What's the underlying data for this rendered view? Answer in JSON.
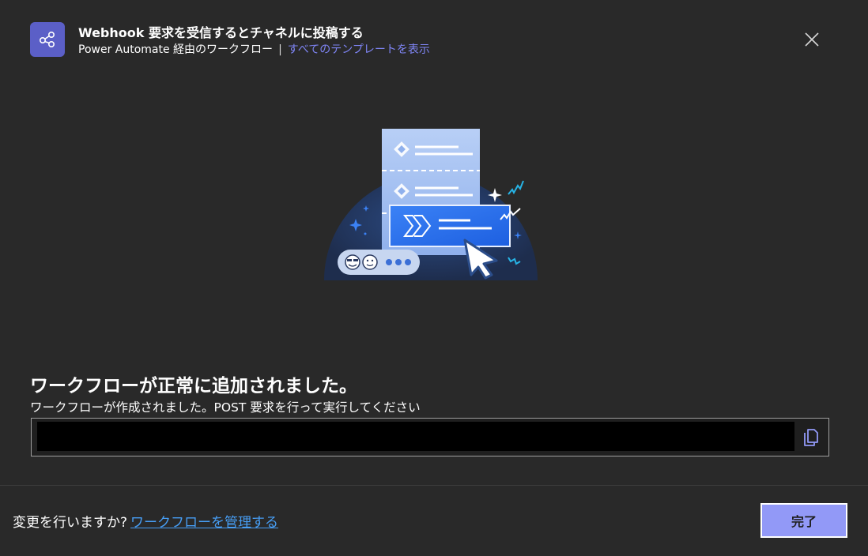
{
  "header": {
    "icon": "flow-share-icon",
    "title": "Webhook 要求を受信するとチャネルに投稿する",
    "subtitle_prefix": "Power Automate 経由のワークフロー",
    "separator": "|",
    "view_templates_link": "すべてのテンプレートを表示",
    "close_icon": "close-icon"
  },
  "illustration": {
    "name": "workflow-success-illustration"
  },
  "main": {
    "success_title": "ワークフローが正常に追加されました。",
    "success_description": "ワークフローが作成されました。POST 要求を行って実行してください",
    "url_value": "",
    "copy_icon": "copy-icon"
  },
  "footer": {
    "question": "変更を行いますか?",
    "manage_link": "ワークフローを管理する",
    "done_label": "完了"
  },
  "colors": {
    "background": "#292929",
    "accent": "#5b5fc7",
    "link": "#7f85f5",
    "footer_link": "#479ef5",
    "primary_button": "#9299f7"
  }
}
